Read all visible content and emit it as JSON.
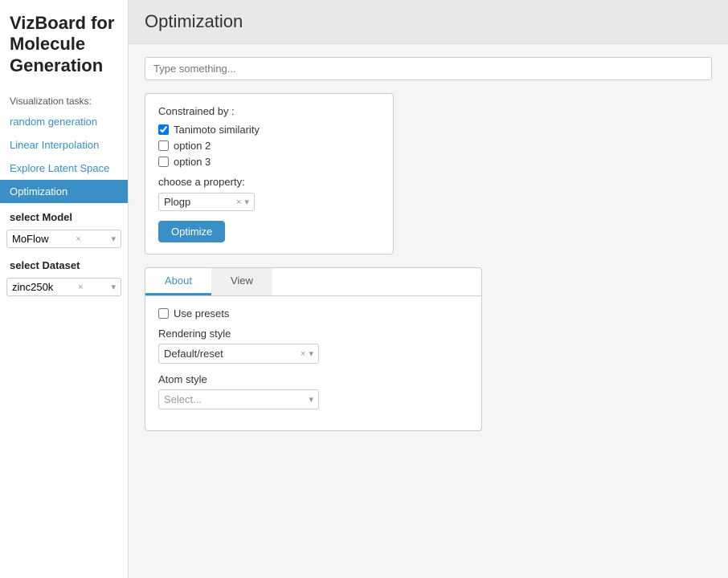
{
  "app": {
    "title": "VizBoard for Molecule Generation"
  },
  "sidebar": {
    "section_label": "Visualization tasks:",
    "items": [
      {
        "id": "random-generation",
        "label": "random generation",
        "active": false
      },
      {
        "id": "linear-interpolation",
        "label": "Linear Interpolation",
        "active": false
      },
      {
        "id": "explore-latent-space",
        "label": "Explore Latent Space",
        "active": false
      },
      {
        "id": "optimization",
        "label": "Optimization",
        "active": true
      }
    ],
    "model_label": "select Model",
    "model_value": "MoFlow",
    "dataset_label": "select Dataset",
    "dataset_value": "zinc250k"
  },
  "main": {
    "page_title": "Optimization",
    "search_placeholder": "Type something...",
    "constraints_panel": {
      "constrained_by_label": "Constrained by :",
      "checkbox1_label": "Tanimoto similarity",
      "checkbox1_checked": true,
      "checkbox2_label": "option 2",
      "checkbox2_checked": false,
      "checkbox3_label": "option 3",
      "checkbox3_checked": false,
      "choose_property_label": "choose a property:",
      "property_value": "Plogp",
      "optimize_label": "Optimize"
    },
    "tabs": {
      "about_label": "About",
      "view_label": "View",
      "active_tab": "about",
      "about_content": {
        "use_presets_label": "Use presets",
        "rendering_style_label": "Rendering style",
        "rendering_value": "Default/reset",
        "atom_style_label": "Atom style",
        "atom_style_placeholder": "Select..."
      }
    }
  }
}
